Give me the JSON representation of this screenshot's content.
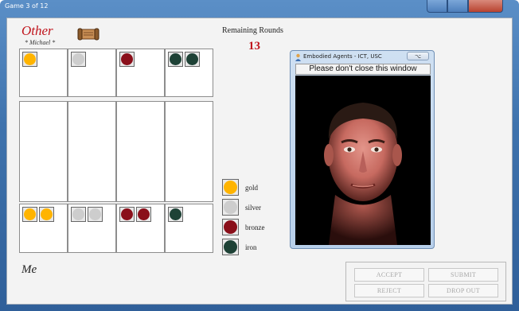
{
  "window": {
    "title": "Game 3 of 12"
  },
  "opponent": {
    "label": "Other",
    "name": "* Michael *"
  },
  "rounds": {
    "label": "Remaining Rounds",
    "value": "13"
  },
  "board": {
    "top_row": [
      {
        "items": [
          "gold"
        ]
      },
      {
        "items": [
          "silver"
        ]
      },
      {
        "items": [
          "bronze"
        ]
      },
      {
        "items": [
          "iron",
          "iron"
        ]
      }
    ],
    "bottom_row": [
      {
        "items": [
          "gold",
          "gold"
        ]
      },
      {
        "items": [
          "silver",
          "silver"
        ]
      },
      {
        "items": [
          "bronze",
          "bronze"
        ]
      },
      {
        "items": [
          "iron"
        ]
      }
    ]
  },
  "legend": [
    {
      "type": "gold",
      "label": "gold"
    },
    {
      "type": "silver",
      "label": "silver"
    },
    {
      "type": "bronze",
      "label": "bronze"
    },
    {
      "type": "iron",
      "label": "iron"
    }
  ],
  "self": {
    "label": "Me"
  },
  "buttons": {
    "accept": "ACCEPT",
    "submit": "SUBMIT",
    "reject": "REJECT",
    "dropout": "DROP OUT"
  },
  "agent_window": {
    "title": "Embodied Agents - ICT, USC",
    "close_glyph": "⌥",
    "banner": "Please don't close this window"
  },
  "colors": {
    "gold": "#ffb400",
    "silver": "#cdcdcd",
    "bronze": "#8a0f1a",
    "iron": "#1e4236",
    "accent_red": "#c0141c"
  },
  "icons": {
    "scroll": "scroll-icon",
    "agent": "person-icon"
  }
}
